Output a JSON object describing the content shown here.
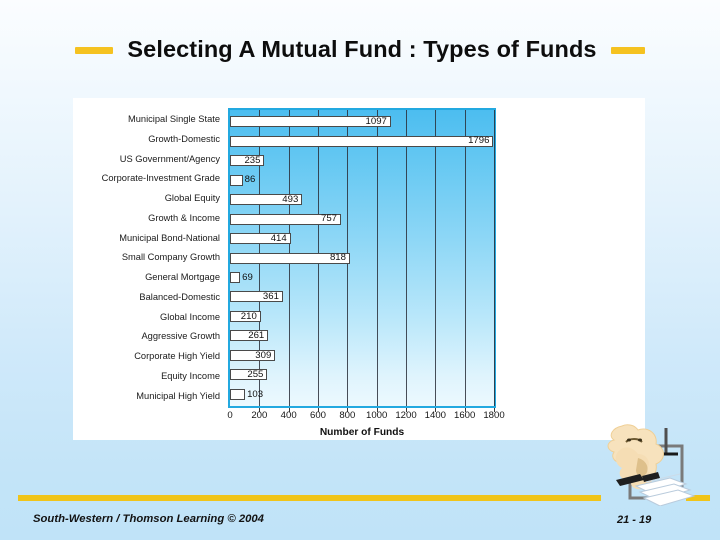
{
  "slide": {
    "title": "Selecting A Mutual Fund : Types of Funds",
    "dash_color": "#f5c220",
    "background_top_color": "#fbfdff",
    "background_bottom_color": "#c0e3f8"
  },
  "footer": {
    "attribution": "South-Western / Thomson Learning © 2004",
    "slide_number": "21 - 19",
    "rule_color": "#f0c419"
  },
  "chart_data": {
    "type": "bar",
    "orientation": "horizontal",
    "title": "",
    "xlabel": "Number of Funds",
    "ylabel": "",
    "xlim": [
      0,
      1800
    ],
    "xticks": [
      0,
      200,
      400,
      600,
      800,
      1000,
      1200,
      1400,
      1600,
      1800
    ],
    "xtick_labels": [
      "0",
      "200",
      "400",
      "600",
      "800",
      "1000",
      "1200",
      "1400",
      "1600",
      "1800"
    ],
    "grid": true,
    "legend": "none",
    "bar_fill_color": "#ffffff",
    "bar_border_color": "#4a4a4a",
    "plot_border_color": "#23a9e0",
    "plot_bg_top_color": "#4cbdf0",
    "plot_bg_bottom_color": "#ecf9fe",
    "categories": [
      "Municipal Single State",
      "Growth-Domestic",
      "US Government/Agency",
      "Corporate-Investment Grade",
      "Global Equity",
      "Growth & Income",
      "Municipal Bond-National",
      "Small Company Growth",
      "General Mortgage",
      "Balanced-Domestic",
      "Global Income",
      "Aggressive Growth",
      "Corporate High Yield",
      "Equity Income",
      "Municipal High Yield"
    ],
    "values": [
      1097,
      1796,
      235,
      86,
      493,
      757,
      414,
      818,
      69,
      361,
      210,
      261,
      309,
      255,
      103
    ],
    "value_labels": [
      "1097",
      "1796",
      "235",
      "86",
      "493",
      "757",
      "414",
      "818",
      "69",
      "361",
      "210",
      "261",
      "309",
      "255",
      "103"
    ]
  },
  "clipart": {
    "name": "thinking-figure-with-papers",
    "body_color": "#f5ddb4",
    "frame_color": "#7a7a7a"
  }
}
